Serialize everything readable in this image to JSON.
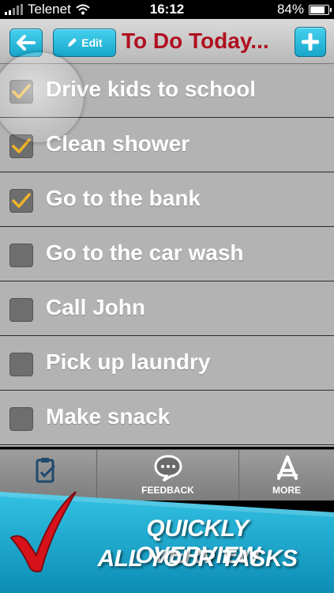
{
  "status_bar": {
    "carrier": "Telenet",
    "time": "16:12",
    "battery": "84%",
    "battery_level": 0.84
  },
  "nav": {
    "edit_label": "Edit",
    "title": "To Do Today..."
  },
  "tasks": [
    {
      "label": "Drive kids to school",
      "checked": true
    },
    {
      "label": "Clean shower",
      "checked": true
    },
    {
      "label": "Go to the bank",
      "checked": true
    },
    {
      "label": "Go to the car wash",
      "checked": false
    },
    {
      "label": "Call John",
      "checked": false
    },
    {
      "label": "Pick up laundry",
      "checked": false
    },
    {
      "label": "Make snack",
      "checked": false
    }
  ],
  "tabs": [
    {
      "icon": "clipboard-icon",
      "label": ""
    },
    {
      "icon": "speech-bubble-icon",
      "label": "FEEDBACK"
    },
    {
      "icon": "app-store-icon",
      "label": "MORE"
    }
  ],
  "promo": {
    "line1": "QUICKLY OVERVIEW",
    "line2": "ALL YOUR TASKS"
  },
  "colors": {
    "accent": "#1fb3d6",
    "title": "#b01020",
    "check": "#f0b429",
    "promo_check": "#d8121b"
  }
}
